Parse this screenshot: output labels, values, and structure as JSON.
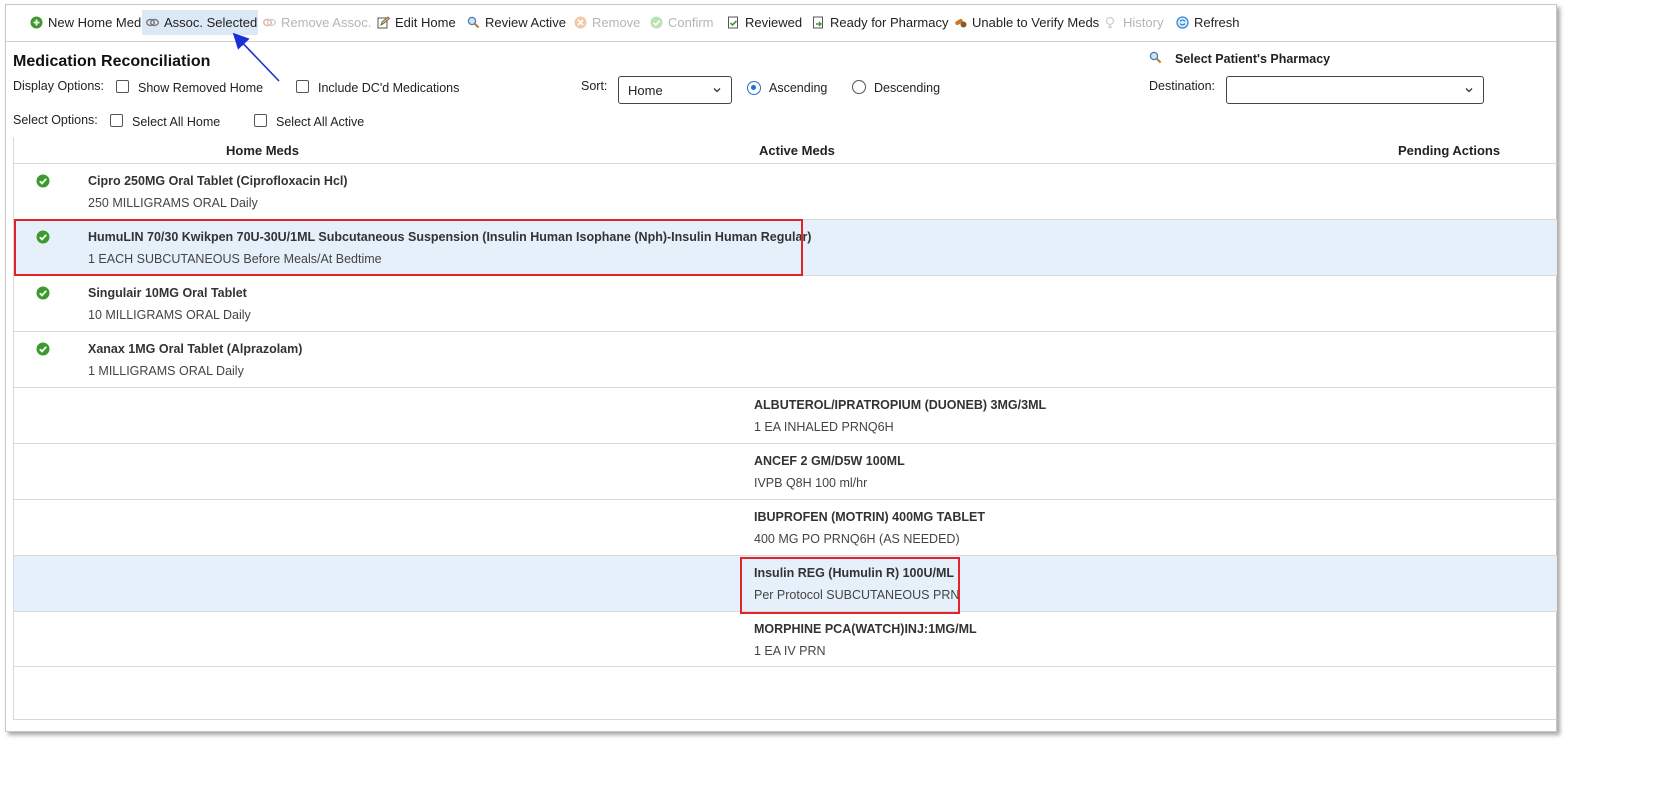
{
  "toolbar": {
    "new_home_med": "New Home Med",
    "assoc_selected": "Assoc. Selected",
    "remove_assoc": "Remove Assoc.",
    "edit_home": "Edit Home",
    "review_active": "Review Active",
    "remove": "Remove",
    "confirm": "Confirm",
    "reviewed": "Reviewed",
    "ready_for_pharmacy": "Ready for Pharmacy",
    "unable_to_verify": "Unable to Verify Meds",
    "history": "History",
    "refresh": "Refresh"
  },
  "header": {
    "title": "Medication Reconciliation",
    "display_options_label": "Display Options:",
    "show_removed_home": "Show Removed Home",
    "include_dc": "Include DC'd Medications",
    "select_options_label": "Select Options:",
    "select_all_home": "Select All Home",
    "select_all_active": "Select All Active",
    "sort_label": "Sort:",
    "sort_value": "Home",
    "ascending": "Ascending",
    "descending": "Descending",
    "pharmacy_title": "Select Patient's Pharmacy",
    "destination_label": "Destination:",
    "destination_value": ""
  },
  "columns": {
    "home": "Home Meds",
    "active": "Active Meds",
    "pending": "Pending Actions"
  },
  "home_meds": [
    {
      "name": "Cipro 250MG Oral Tablet (Ciprofloxacin Hcl)",
      "sig": "250 MILLIGRAMS ORAL Daily"
    },
    {
      "name": "HumuLIN 70/30 Kwikpen 70U-30U/1ML Subcutaneous Suspension (Insulin Human Isophane (Nph)-Insulin Human Regular)",
      "sig": "1 EACH SUBCUTANEOUS Before Meals/At Bedtime"
    },
    {
      "name": "Singulair 10MG Oral Tablet",
      "sig": "10 MILLIGRAMS ORAL Daily"
    },
    {
      "name": "Xanax 1MG Oral Tablet (Alprazolam)",
      "sig": "1 MILLIGRAMS ORAL Daily"
    }
  ],
  "active_meds": [
    {
      "name": "ALBUTEROL/IPRATROPIUM (DUONEB) 3MG/3ML",
      "sig": "1 EA INHALED PRNQ6H"
    },
    {
      "name": "ANCEF 2 GM/D5W 100ML",
      "sig": "IVPB Q8H 100 ml/hr"
    },
    {
      "name": "IBUPROFEN (MOTRIN) 400MG TABLET",
      "sig": "400 MG PO PRNQ6H (AS NEEDED)"
    },
    {
      "name": "Insulin REG (Humulin R) 100U/ML",
      "sig": "Per Protocol SUBCUTANEOUS PRN"
    },
    {
      "name": "MORPHINE PCA(WATCH)INJ:1MG/ML",
      "sig": "1 EA IV PRN"
    }
  ],
  "colors": {
    "selected_row": "#e5f0fb",
    "highlight_box": "#e0242a",
    "annotation_arrow": "#1a2fd6",
    "check_green": "#3e9a2e",
    "radio_blue": "#1e6fd0"
  }
}
